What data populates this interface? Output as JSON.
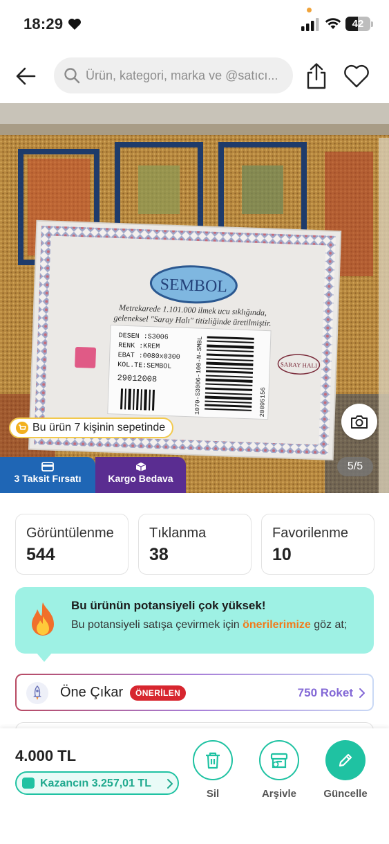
{
  "status_bar": {
    "time": "18:29",
    "battery": "42"
  },
  "search": {
    "placeholder": "Ürün, kategori, marka ve @satıcı..."
  },
  "image": {
    "in_cart_text": "Bu ürün 7 kişinin sepetinde",
    "counter": "5/5",
    "tag_installment": "3 Taksit Fırsatı",
    "tag_shipping": "Kargo Bedava",
    "label_brand": "SEMBOL",
    "label_line1": "Metrekarede 1.101.000 ilmek ucu sıklığında,",
    "label_line2": "geleneksel \"Saray Halı\" titizliğinde üretilmiştir.",
    "label_desen": "DESEN :S3006",
    "label_renk": "RENK  :KREM",
    "label_ebat": "EBAT  :0080x0300",
    "label_kol": "KOL.TE:SEMBOL",
    "label_number": "29012008",
    "label_saray": "SARAY HALI",
    "label_barcode": "1070-S3006-100-N-SMBL",
    "label_serial": "20095156"
  },
  "stats": [
    {
      "label": "Görüntülenme",
      "value": "544"
    },
    {
      "label": "Tıklanma",
      "value": "38"
    },
    {
      "label": "Favorilenme",
      "value": "10"
    }
  ],
  "potential": {
    "title": "Bu ürünün potansiyeli çok yüksek!",
    "desc_before": "Bu potansiyeli satışa çevirmek için ",
    "desc_link": "önerilerimize",
    "desc_after": " göz at;"
  },
  "promote": {
    "label": "Öne Çıkar",
    "badge": "ÖNERİLEN",
    "price": "750 Roket"
  },
  "bottom": {
    "price": "4.000 TL",
    "earn": "Kazancın 3.257,01 TL",
    "delete_label": "Sil",
    "archive_label": "Arşivle",
    "update_label": "Güncelle"
  },
  "colors": {
    "accent": "#1fc2a2",
    "potential_bg": "#9ef1e4",
    "link_orange": "#f27a1a",
    "badge_red": "#d7262f",
    "installment_blue": "#1f66b5",
    "shipping_purple": "#5a2d91",
    "rocket_purple": "#8368d6"
  }
}
